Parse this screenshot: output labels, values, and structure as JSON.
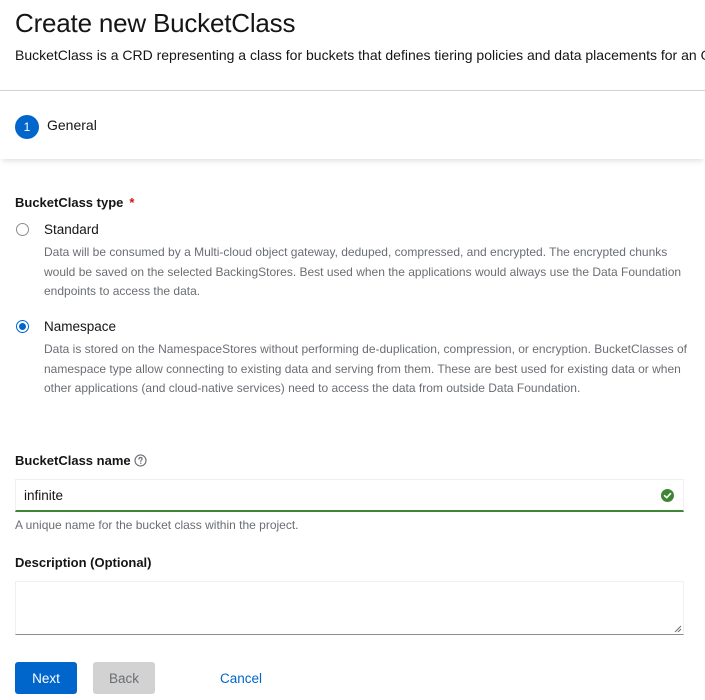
{
  "header": {
    "title": "Create new BucketClass",
    "description": "BucketClass is a CRD representing a class for buckets that defines tiering policies and data placements for an OBC."
  },
  "wizard": {
    "steps": [
      {
        "number": "1",
        "label": "General",
        "active": true
      }
    ]
  },
  "bucketclass_type": {
    "label": "BucketClass type",
    "required_mark": "*",
    "options": [
      {
        "label": "Standard",
        "selected": false,
        "description": "Data will be consumed by a Multi-cloud object gateway, deduped, compressed, and encrypted. The encrypted chunks would be saved on the selected BackingStores. Best used when the applications would always use the Data Foundation endpoints to access the data."
      },
      {
        "label": "Namespace",
        "selected": true,
        "description": "Data is stored on the NamespaceStores without performing de-duplication, compression, or encryption. BucketClasses of namespace type allow connecting to existing data and serving from them. These are best used for existing data or when other applications (and cloud-native services) need to access the data from outside Data Foundation."
      }
    ]
  },
  "name_field": {
    "label": "BucketClass name",
    "value": "infinite",
    "helper": "A unique name for the bucket class within the project.",
    "help_icon": "question-circle-icon",
    "status_icon": "check-circle-icon",
    "status_color": "#3e8635"
  },
  "description_field": {
    "label": "Description (Optional)",
    "value": ""
  },
  "actions": {
    "next_label": "Next",
    "back_label": "Back",
    "cancel_label": "Cancel"
  },
  "colors": {
    "primary": "#0066cc",
    "success": "#3e8635",
    "required": "#c9190b"
  }
}
